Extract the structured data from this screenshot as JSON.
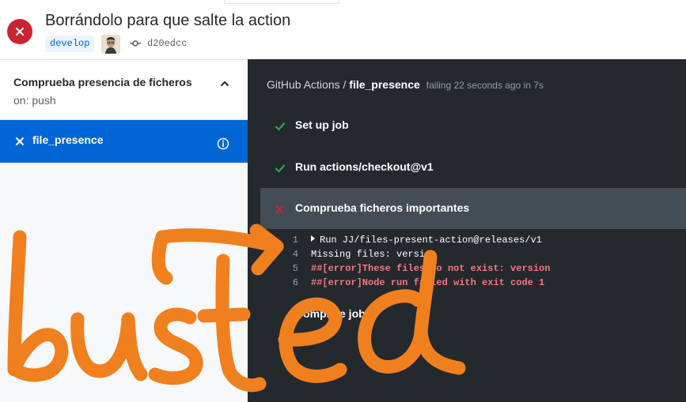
{
  "header": {
    "title": "Borrándolo para que salte la action",
    "branch": "develop",
    "commit_sha": "d20edcc",
    "status": "failure"
  },
  "sidebar": {
    "workflow_name": "Comprueba presencia de ficheros",
    "trigger": "on: push",
    "jobs": [
      {
        "name": "file_presence",
        "status": "failure",
        "selected": true
      }
    ]
  },
  "log": {
    "workflow": "GitHub Actions",
    "separator": " / ",
    "job": "file_presence",
    "meta": "failing 22 seconds ago in 7s",
    "steps": [
      {
        "label": "Set up job",
        "status": "success"
      },
      {
        "label": "Run actions/checkout@v1",
        "status": "success"
      },
      {
        "label": "Comprueba ficheros importantes",
        "status": "failure"
      },
      {
        "label": "Complete job",
        "status": "success"
      }
    ],
    "lines": [
      {
        "num": "1",
        "text": "Run JJ/files-present-action@releases/v1"
      },
      {
        "num": "4",
        "text": "Missing files: version"
      },
      {
        "num": "5",
        "text": "##[error]These files do not exist: version"
      },
      {
        "num": "6",
        "text": "##[error]Node run failed with exit code 1"
      }
    ]
  },
  "annotation": {
    "text": "busted",
    "color": "#f0801e"
  },
  "colors": {
    "failure": "#cb2431",
    "success": "#28a745",
    "selected_job": "#0366d6",
    "log_background": "#24292e",
    "error_text": "#f97583"
  }
}
